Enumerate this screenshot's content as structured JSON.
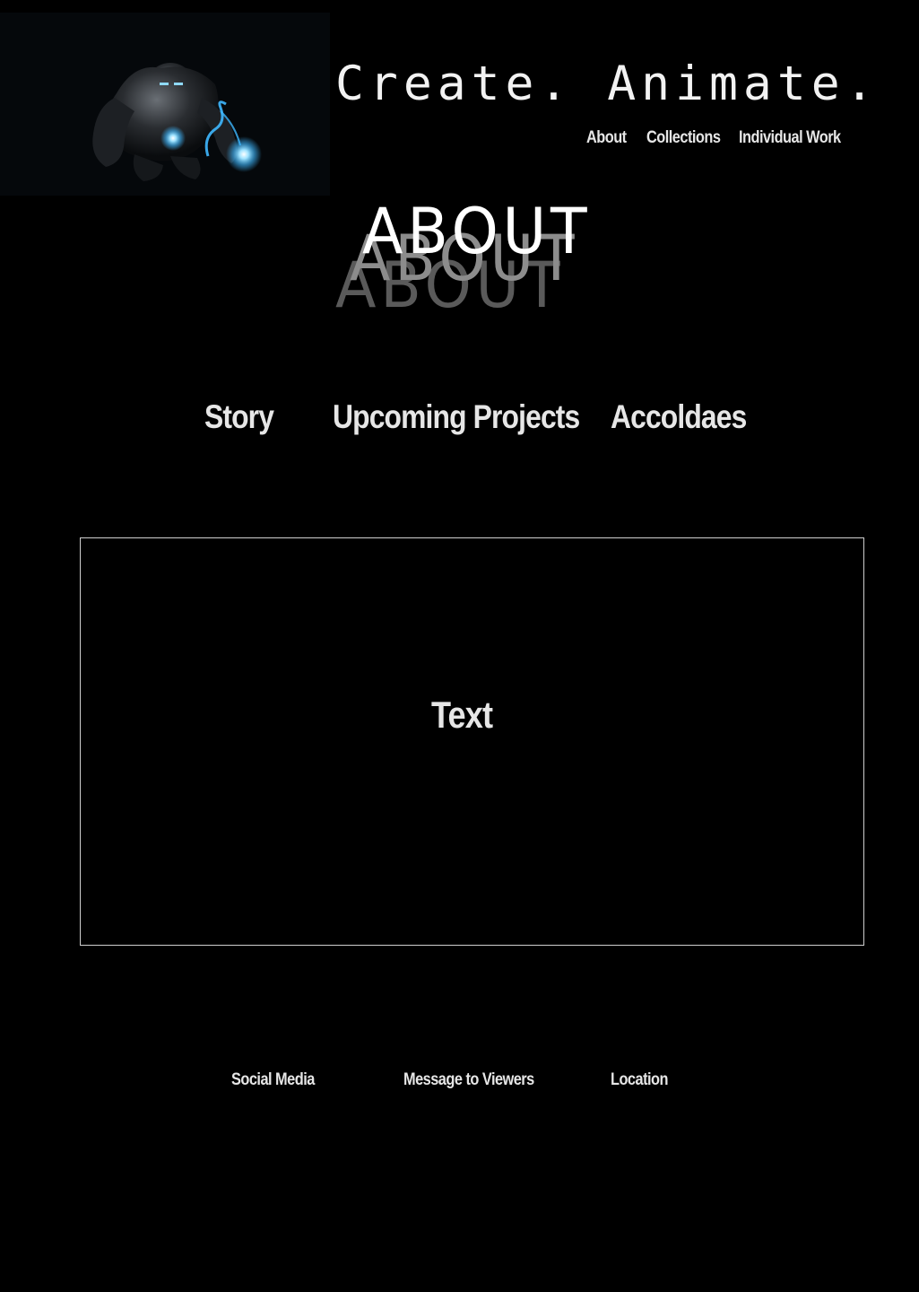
{
  "header": {
    "tagline": "Create. Animate.",
    "hero_image": "armored-hero-with-blue-glowing-energy-image"
  },
  "topnav": {
    "about": "About",
    "collections": "Collections",
    "individual_work": "Individual Work"
  },
  "page": {
    "title": "ABOUT"
  },
  "subnav": {
    "story": "Story",
    "upcoming": "Upcoming Projects",
    "accolades": "Accoldaes"
  },
  "content": {
    "text": "Text"
  },
  "footer": {
    "social": "Social Media",
    "message": "Message to Viewers",
    "location": "Location"
  },
  "colors": {
    "background": "#000000",
    "text": "#e6e6e6",
    "glow": "#3fb8ff",
    "title_shadow_1": "#8c8c8c",
    "title_shadow_2": "#5a5a5a"
  }
}
